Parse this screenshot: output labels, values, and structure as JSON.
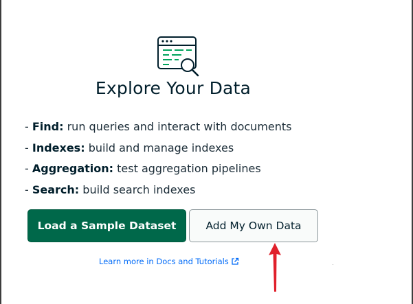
{
  "heading": "Explore Your Data",
  "features": [
    {
      "term": "Find:",
      "desc": " run queries and interact with documents"
    },
    {
      "term": "Indexes:",
      "desc": " build and manage indexes"
    },
    {
      "term": "Aggregation:",
      "desc": " test aggregation pipelines"
    },
    {
      "term": "Search:",
      "desc": " build search indexes"
    }
  ],
  "bullet_prefix": "- ",
  "buttons": {
    "load_sample": "Load a Sample Dataset",
    "add_own": "Add My Own Data"
  },
  "learn_more_link": "Learn more in Docs and Tutorials",
  "icons": {
    "illustration": "explore-data-magnifier-icon",
    "external_link": "external-link-icon",
    "annotation": "red-arrow-annotation"
  },
  "colors": {
    "primary_green": "#00684A",
    "accent_green": "#00A35C",
    "text_dark": "#001E2B",
    "link_blue": "#016BF8",
    "annotation_red": "#E0202B"
  }
}
